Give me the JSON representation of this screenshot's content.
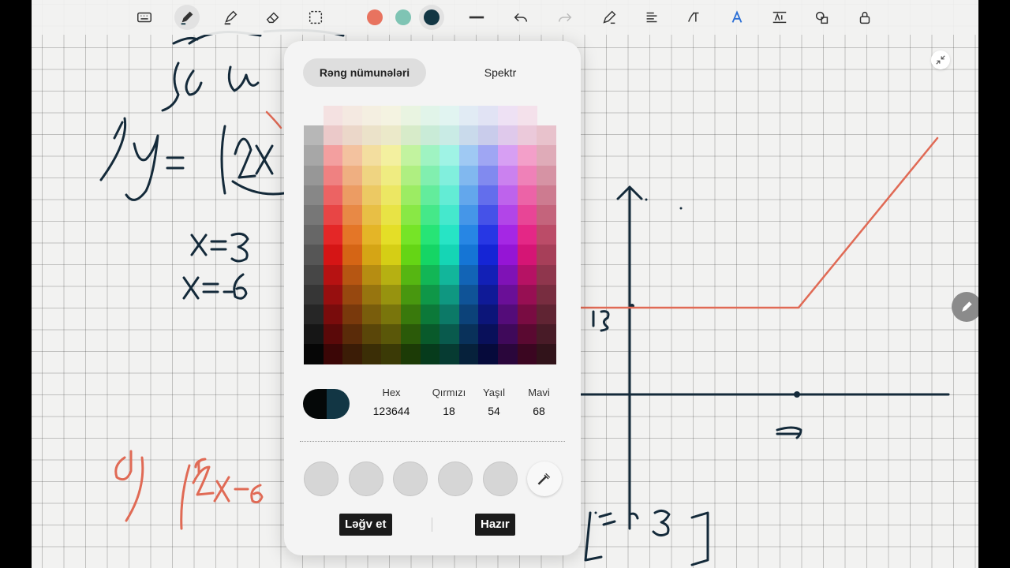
{
  "toolbar": {
    "tools": [
      {
        "name": "keyboard-icon",
        "active": false
      },
      {
        "name": "pen-icon",
        "active": true
      },
      {
        "name": "highlighter-icon",
        "active": false
      },
      {
        "name": "eraser-icon",
        "active": false
      },
      {
        "name": "lasso-select-icon",
        "active": false
      }
    ],
    "colors": [
      "#e8735f",
      "#7fc4b4",
      "#123644"
    ],
    "selected_color_index": 2
  },
  "picker": {
    "tab_samples": "Rəng nümunələri",
    "tab_spectrum": "Spektr",
    "hex_label": "Hex",
    "hex_value": "123644",
    "red_label": "Qırmızı",
    "red_value": "18",
    "green_label": "Yaşıl",
    "green_value": "54",
    "blue_label": "Mavi",
    "blue_value": "68",
    "preview_colors": [
      "#050808",
      "#123644"
    ],
    "recent_slot_count": 5,
    "cancel_label": "Ləğv et",
    "done_label": "Hazır"
  }
}
